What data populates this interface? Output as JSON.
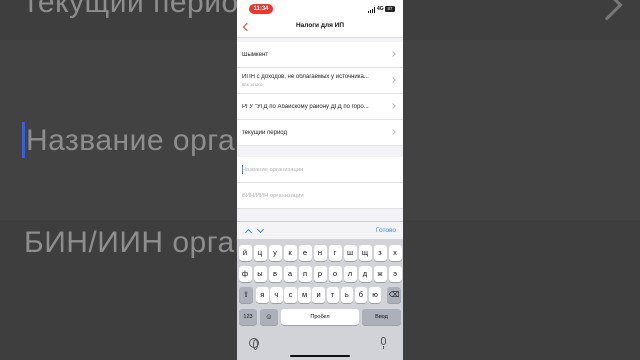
{
  "background": {
    "left_texts": [
      "текущий период",
      "Название организации",
      "БИН/ИИН организации"
    ],
    "accent_color": "#3b5fd9"
  },
  "status_bar": {
    "time": "11:34",
    "network": "4G",
    "battery": "87",
    "time_color": "#e8382f"
  },
  "nav": {
    "back_icon": "chevron-left-icon",
    "title": "Налоги для ИП",
    "accent_color": "#e0452f"
  },
  "list": [
    {
      "label": "Шымкент",
      "sub": ""
    },
    {
      "label": "ИПН с доходов, не облагаемых у источника...",
      "sub": "КБК 101202"
    },
    {
      "label": "РГУ \"УГД по Абайскому району ДГД по горо...",
      "sub": ""
    },
    {
      "label": "текущий период",
      "sub": ""
    }
  ],
  "fields": {
    "org_name": {
      "placeholder": "Название организации",
      "value": ""
    },
    "bin": {
      "placeholder": "БИН/ИИН организации",
      "value": ""
    }
  },
  "keyboard": {
    "toolbar": {
      "done": "Готово",
      "accent_color": "#3a8ee6"
    },
    "row1": [
      "й",
      "ц",
      "у",
      "к",
      "е",
      "н",
      "г",
      "ш",
      "щ",
      "з",
      "х"
    ],
    "row2": [
      "ф",
      "ы",
      "в",
      "а",
      "п",
      "р",
      "о",
      "л",
      "д",
      "ж",
      "э"
    ],
    "row3": [
      "я",
      "ч",
      "с",
      "м",
      "и",
      "т",
      "ь",
      "б",
      "ю"
    ],
    "numbers_key": "123",
    "space_label": "Пробел",
    "return_label": "Ввод"
  }
}
